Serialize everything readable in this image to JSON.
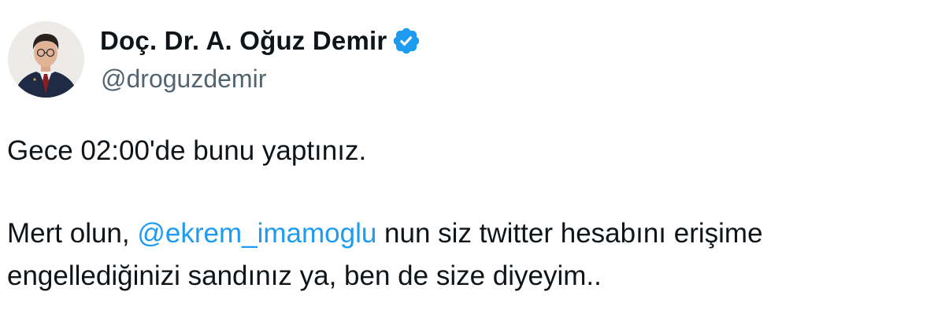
{
  "author": {
    "display_name": "Doç. Dr. A. Oğuz Demir",
    "handle": "@droguzdemir",
    "verified": true,
    "avatar_icon": "profile-photo"
  },
  "tweet": {
    "paragraph1": "Gece 02:00'de bunu yaptınız.",
    "paragraph2_before_mention": "Mert olun, ",
    "mention": "@ekrem_imamoglu",
    "paragraph2_after_mention": " nun siz twitter hesabını erişime",
    "paragraph2_line2": "engellediğinizi sandınız ya, ben de size diyeyim.."
  },
  "colors": {
    "text_primary": "#0f1419",
    "text_secondary": "#536471",
    "link": "#1d9bf0",
    "verified_badge": "#1d9bf0",
    "background": "#ffffff"
  }
}
